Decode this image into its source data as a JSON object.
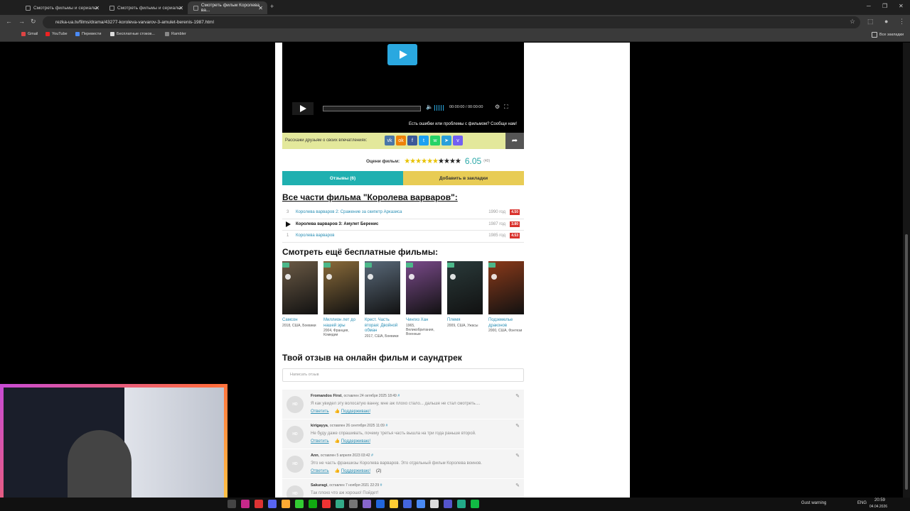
{
  "browser": {
    "tabs": [
      {
        "label": "Смотреть фильмы и сериалы"
      },
      {
        "label": "Смотреть фильмы и сериалы"
      },
      {
        "label": "Смотреть фильм Королева ва..."
      }
    ],
    "url": "rezka-ua.tv/films/drama/43277-koroleva-varvarov-3-amulet-berenis-1987.html",
    "bookmarks": [
      "Gmail",
      "YouTube",
      "Перевести",
      "Бесплатные стоков...",
      "Rambler"
    ],
    "all_bookmarks": "Все закладки"
  },
  "player": {
    "time": "00:00:00 / 00:00:00",
    "report": "Есть ошибки или проблемы с фильмом? Сообщи нам!",
    "share_label": "Расскажи друзьям о своих впечатлениях:"
  },
  "rating": {
    "label": "Оцени фильм:",
    "stars_filled": 6,
    "stars_total": 10,
    "score": "6.05",
    "votes": "(40)"
  },
  "actions": {
    "reviews": "Отзывы (6)",
    "bookmark": "Добавить в закладки"
  },
  "parts": {
    "heading": "Все части фильма \"Королева варваров\":",
    "items": [
      {
        "num": "3",
        "title": "Королева варваров 2: Сражение за скипетр Арказиса",
        "year": "1990 год",
        "rating": "4.50",
        "current": false
      },
      {
        "num": "",
        "title": "Королева варваров 3: Амулет Беренис",
        "year": "1987 год",
        "rating": "3.80",
        "current": true
      },
      {
        "num": "1",
        "title": "Королева варваров",
        "year": "1985 год",
        "rating": "4.53",
        "current": false
      }
    ]
  },
  "free": {
    "heading": "Смотреть ещё бесплатные фильмы:",
    "films": [
      {
        "title": "Самсон",
        "meta": "2018, США, Боевики",
        "color": "#6b5a45"
      },
      {
        "title": "Миллион лет до нашей эры",
        "meta": "2004, Франция, Комедии",
        "color": "#8a6b3a"
      },
      {
        "title": "Крест. Часть вторая: Двойной обман",
        "meta": "2017, США, Боевики",
        "color": "#5a6a7a"
      },
      {
        "title": "Чингиз Хан",
        "meta": "1965, Великобритания, Военные",
        "color": "#7a4a8a"
      },
      {
        "title": "Племя",
        "meta": "2009, США, Ужасы",
        "color": "#2a3a3a"
      },
      {
        "title": "Подземелье драконов",
        "meta": "2000, США, Фэнтези",
        "color": "#8a3a1a"
      }
    ]
  },
  "review": {
    "heading": "Твой отзыв на онлайн фильм и саундтрек",
    "placeholder": "Написать отзыв"
  },
  "comments": [
    {
      "author": "Fromandos First",
      "date": "оставлен 24 октября 2025 18:49",
      "text": "Я как увидел эту волосатую ванну, мне аж плохо стало... дальше не стал смотреть....",
      "reply": "Ответить",
      "like": "Поддерживаю!",
      "count": ""
    },
    {
      "author": "kirigayya",
      "date": "оставлен 26 сентября 2025 11:09",
      "text": "Не буду даже спрашивать, почему третья часть вышла на три года раньше второй.",
      "reply": "Ответить",
      "like": "Поддерживаю!",
      "count": ""
    },
    {
      "author": "Ann",
      "date": "оставлен 5 апреля 2023 03:42",
      "text": "Это не часть франшизы Королева варваров. Это отдельный фильм Королева воинов.",
      "reply": "Ответить",
      "like": "Поддерживаю!",
      "count": "(2)"
    },
    {
      "author": "Sakuragi",
      "date": "оставлен 7 ноября 2021 22:29",
      "text": "Так плохо что аж хорошо! Пойдет!",
      "reply": "",
      "like": "",
      "count": ""
    }
  ],
  "taskbar": {
    "notice": "Gust warning",
    "lang": "ENG",
    "time": "20:59",
    "date": "04.04.2026"
  }
}
